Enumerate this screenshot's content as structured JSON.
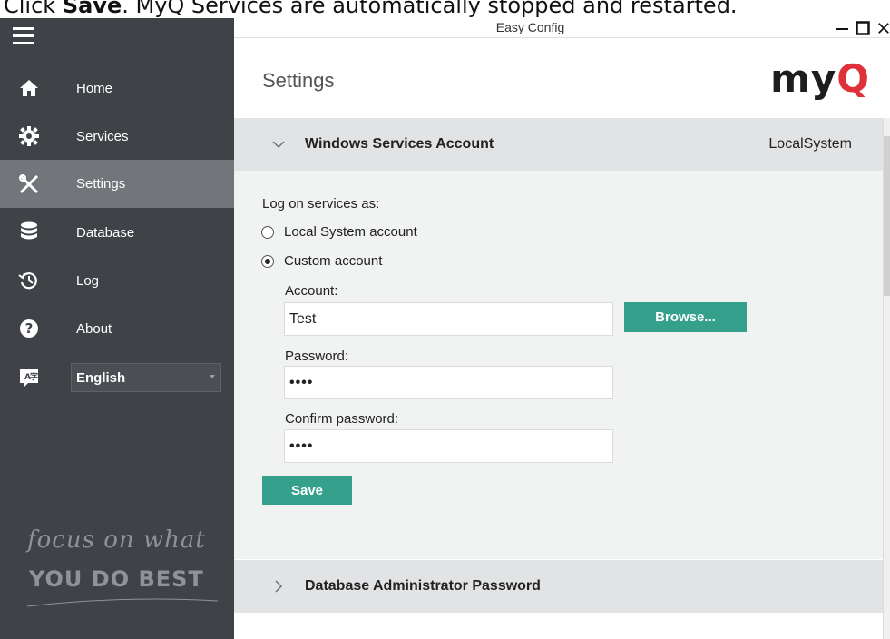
{
  "caption": {
    "prefix": "Click ",
    "bold": "Save",
    "suffix": ". MyQ Services are automatically stopped and restarted."
  },
  "window": {
    "title": "Easy Config",
    "controls": [
      "minimize",
      "maximize",
      "close"
    ]
  },
  "sidebar": {
    "items": [
      {
        "label": "Home",
        "icon": "home-icon",
        "active": false
      },
      {
        "label": "Services",
        "icon": "gear-icon",
        "active": false
      },
      {
        "label": "Settings",
        "icon": "tools-icon",
        "active": true
      },
      {
        "label": "Database",
        "icon": "database-icon",
        "active": false
      },
      {
        "label": "Log",
        "icon": "history-icon",
        "active": false
      },
      {
        "label": "About",
        "icon": "help-icon",
        "active": false
      }
    ],
    "language": {
      "icon": "language-icon",
      "selected": "English"
    },
    "slogan": {
      "line1": "focus on what",
      "line2": "YOU DO BEST"
    }
  },
  "header": {
    "title": "Settings",
    "logo": {
      "part1": "my",
      "part2": "Q"
    }
  },
  "sections": [
    {
      "title": "Windows Services Account",
      "value": "LocalSystem",
      "expanded": true,
      "body": {
        "log_on_label": "Log on services as:",
        "options": [
          {
            "label": "Local System account",
            "checked": false
          },
          {
            "label": "Custom account",
            "checked": true
          }
        ],
        "account_label": "Account:",
        "account_value": "Test",
        "browse_label": "Browse...",
        "password_label": "Password:",
        "password_value": "••••",
        "confirm_label": "Confirm password:",
        "confirm_value": "••••",
        "save_label": "Save"
      }
    },
    {
      "title": "Database Administrator Password",
      "expanded": false
    }
  ],
  "colors": {
    "sidebar_bg": "#3f4246",
    "sidebar_active": "#72767b",
    "accent_green": "#35a08c",
    "logo_red": "#e0303a",
    "section_header_bg": "#e2e3e4",
    "section_body_bg": "#f1f2f2"
  }
}
